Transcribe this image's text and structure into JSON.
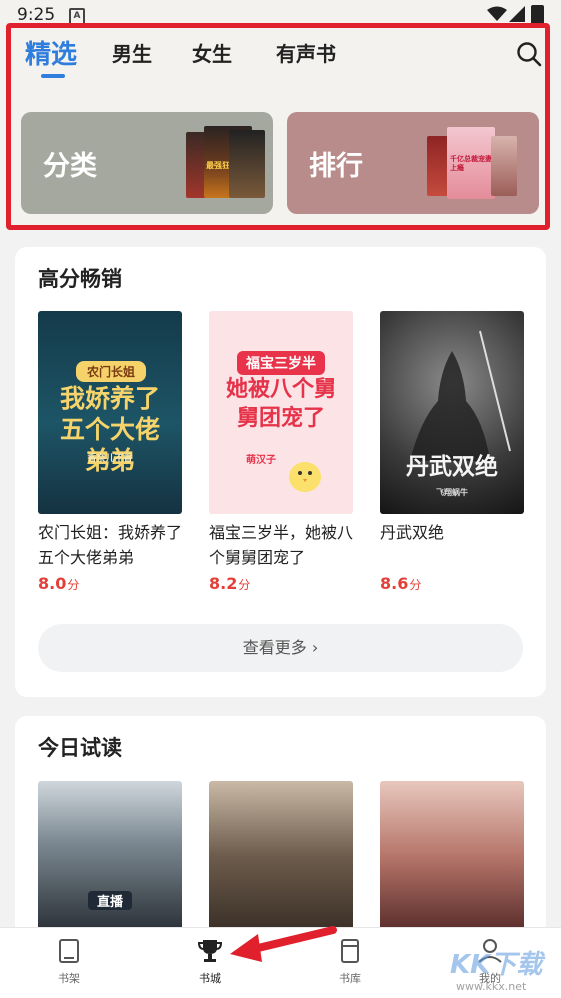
{
  "status_bar": {
    "time": "9:25",
    "notification_letter": "A"
  },
  "top_nav": {
    "tabs": [
      {
        "label": "精选",
        "active": true
      },
      {
        "label": "男生",
        "active": false
      },
      {
        "label": "女生",
        "active": false
      },
      {
        "label": "有声书",
        "active": false
      }
    ],
    "search_icon": "search-icon"
  },
  "category_tiles": [
    {
      "label": "分类",
      "cover_text": "最强狂中"
    },
    {
      "label": "排行",
      "cover_text": "千亿总裁宠妻上瘾"
    }
  ],
  "section_bestsellers": {
    "title": "高分畅销",
    "books": [
      {
        "title": "农门长姐：我娇养了五个大佬弟弟",
        "score": "8.0",
        "unit": "分",
        "cover_tag": "农门长姐",
        "cover_headline": "我娇养了五个大佬弟弟",
        "cover_author": "香奈儿不香"
      },
      {
        "title": "福宝三岁半，她被八个舅舅团宠了",
        "score": "8.2",
        "unit": "分",
        "cover_tag": "福宝三岁半",
        "cover_headline": "她被八个舅舅团宠了",
        "cover_author": "萌汉子"
      },
      {
        "title": "丹武双绝",
        "score": "8.6",
        "unit": "分",
        "cover_headline": "丹武双绝",
        "cover_author": "飞翔蜗牛"
      }
    ],
    "more_label": "查看更多 ›"
  },
  "section_trial": {
    "title": "今日试读",
    "cover_tag": "直播"
  },
  "bottom_tabs": [
    {
      "label": "书架",
      "icon": "bookshelf-icon",
      "active": false
    },
    {
      "label": "书城",
      "icon": "trophy-icon",
      "active": true
    },
    {
      "label": "书库",
      "icon": "library-icon",
      "active": false
    },
    {
      "label": "我的",
      "icon": "profile-icon",
      "active": false
    }
  ],
  "watermark": {
    "brand": "KK下载",
    "url": "www.kkx.net"
  },
  "colors": {
    "accent": "#2f7ddc",
    "score": "#e3403a",
    "frame": "#e0202c"
  }
}
